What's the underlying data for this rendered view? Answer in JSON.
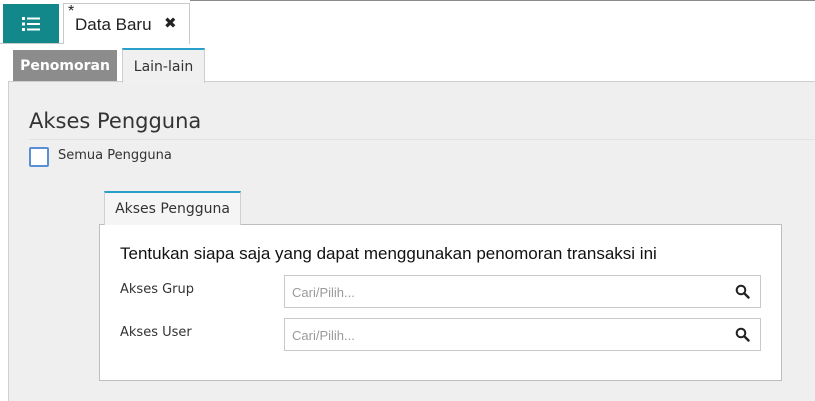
{
  "topbar": {
    "menu_icon": "list-icon",
    "doc_tab": {
      "modified_mark": "*",
      "label": "Data Baru",
      "close_glyph": "✖"
    }
  },
  "tabs": [
    {
      "label": "Penomoran",
      "active": false
    },
    {
      "label": "Lain-lain",
      "active": true
    }
  ],
  "section": {
    "title": "Akses Pengguna",
    "checkbox_label": "Semua Pengguna",
    "checkbox_checked": false
  },
  "inner": {
    "tab_label": "Akses Pengguna",
    "description": "Tentukan siapa saja yang dapat menggunakan penomoran transaksi ini",
    "fields": [
      {
        "label": "Akses Grup",
        "placeholder": "Cari/Pilih...",
        "value": ""
      },
      {
        "label": "Akses User",
        "placeholder": "Cari/Pilih...",
        "value": ""
      }
    ]
  },
  "colors": {
    "accent": "#12888a",
    "tab_inactive": "#8c8c8c",
    "tab_active_border": "#2a9fc9",
    "checkbox_border": "#5a8fd6"
  }
}
